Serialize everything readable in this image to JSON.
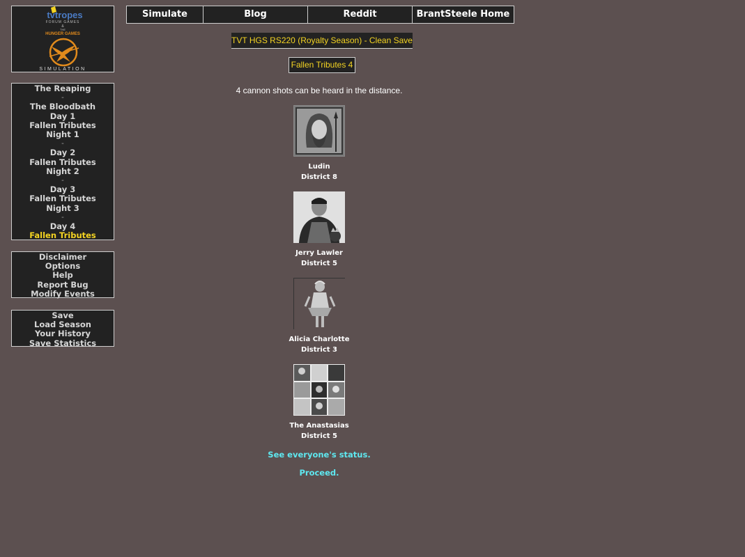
{
  "logo": {
    "brand_text": "tvtropes",
    "sub_text": "FORUM GAMES",
    "amp_text": "&",
    "the_text": "THE",
    "hunger_games_text": "HUNGER GAMES",
    "simulation_text": "SIMULATION"
  },
  "nav": {
    "reaping": "The Reaping",
    "sep1": "-",
    "bloodbath": "The Bloodbath",
    "day1": "Day 1",
    "fallen1": "Fallen Tributes",
    "night1": "Night 1",
    "sep2": "-",
    "day2": "Day 2",
    "fallen2": "Fallen Tributes",
    "night2": "Night 2",
    "sep3": "-",
    "day3": "Day 3",
    "fallen3": "Fallen Tributes",
    "night3": "Night 3",
    "sep4": "-",
    "day4": "Day 4",
    "fallen4": "Fallen Tributes"
  },
  "menu": {
    "disclaimer": "Disclaimer",
    "options": "Options",
    "help": "Help",
    "report_bug": "Report Bug",
    "modify_events": "Modify Events"
  },
  "save_menu": {
    "save": "Save",
    "load_season": "Load Season",
    "your_history": "Your History",
    "save_statistics": "Save Statistics"
  },
  "top_nav": {
    "simulate": "Simulate",
    "blog": "Blog",
    "reddit": "Reddit",
    "home": "BrantSteele Home"
  },
  "season_title": "TVT HGS RS220 (Royalty Season) - Clean Save",
  "phase_title": "Fallen Tributes 4",
  "cannon_text": "4 cannon shots can be heard in the distance.",
  "tributes": [
    {
      "name": "Ludin",
      "district": "District 8"
    },
    {
      "name": "Jerry Lawler",
      "district": "District 5"
    },
    {
      "name": "Alicia Charlotte",
      "district": "District 3"
    },
    {
      "name": "The Anastasias",
      "district": "District 5"
    }
  ],
  "links": {
    "status": "See everyone's status.",
    "proceed": "Proceed."
  },
  "colors": {
    "background": "#5c5050",
    "panel": "#222222",
    "accent_yellow": "#f4d422",
    "link_cyan": "#5ee8f0"
  }
}
